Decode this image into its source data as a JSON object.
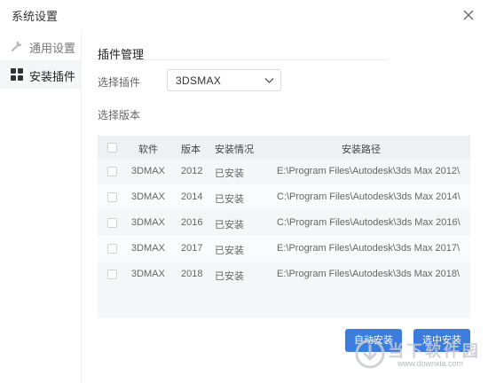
{
  "window": {
    "title": "系统设置"
  },
  "sidebar": {
    "items": [
      {
        "label": "通用设置",
        "icon": "wrench-icon",
        "active": false
      },
      {
        "label": "安装插件",
        "icon": "grid-icon",
        "active": true
      }
    ]
  },
  "main": {
    "section_title": "插件管理",
    "plugin_label": "选择插件",
    "plugin_selected": "3DSMAX",
    "version_label": "选择版本",
    "table": {
      "headers": [
        "软件",
        "版本",
        "安装情况",
        "安装路径"
      ],
      "rows": [
        {
          "name": "3DMAX",
          "version": "2012",
          "status": "已安装",
          "path": "E:\\Program Files\\Autodesk\\3ds Max 2012\\"
        },
        {
          "name": "3DMAX",
          "version": "2014",
          "status": "已安装",
          "path": "C:\\Program Files\\Autodesk\\3ds Max 2014\\"
        },
        {
          "name": "3DMAX",
          "version": "2016",
          "status": "已安装",
          "path": "C:\\Program Files\\Autodesk\\3ds Max 2016\\"
        },
        {
          "name": "3DMAX",
          "version": "2017",
          "status": "已安装",
          "path": "E:\\Program Files\\Autodesk\\3ds Max 2017\\"
        },
        {
          "name": "3DMAX",
          "version": "2018",
          "status": "已安装",
          "path": "E:\\Program Files\\Autodesk\\3ds Max 2018\\"
        }
      ]
    },
    "buttons": {
      "auto_install": "自动安装",
      "install_selected": "选中安装"
    }
  },
  "watermark": {
    "text": "当下软件园",
    "url": "www.downxia.com"
  },
  "colors": {
    "accent": "#3b7ddd",
    "table_bg": "#f5f6f8",
    "header_bg": "#eef0f3"
  }
}
